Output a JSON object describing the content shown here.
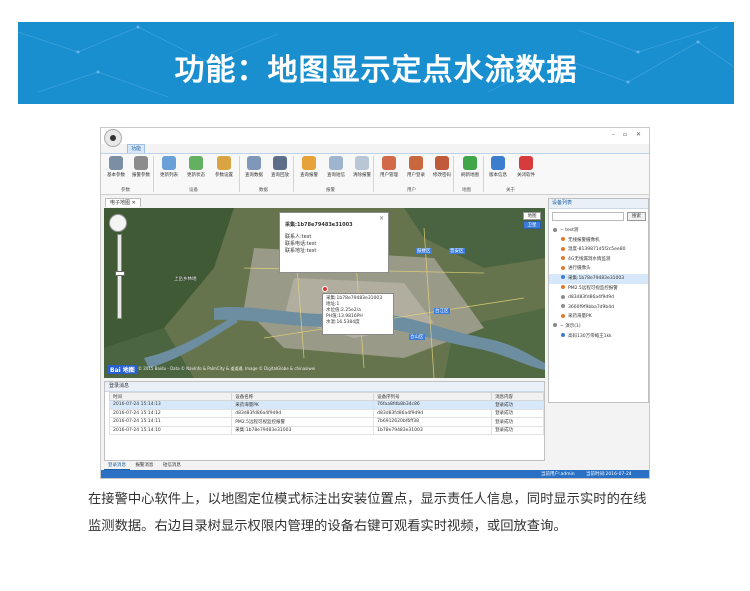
{
  "banner": {
    "title": "功能：地图显示定点水流数据"
  },
  "app": {
    "tab": "功能",
    "window_controls": [
      "–",
      "▫",
      "✕"
    ],
    "ribbon": {
      "buttons": [
        {
          "label": "基本参数",
          "color": "#7a8ea4"
        },
        {
          "label": "报警参数",
          "color": "#8c8c8c"
        },
        {
          "label": "更新列表",
          "color": "#6aa0d8"
        },
        {
          "label": "更新状态",
          "color": "#62b060"
        },
        {
          "label": "参数设置",
          "color": "#d9a441"
        },
        {
          "label": "查询数据",
          "color": "#7f97b8"
        },
        {
          "label": "查询回放",
          "color": "#5e6e88"
        },
        {
          "label": "查询报警",
          "color": "#e8a23a"
        },
        {
          "label": "查询短信",
          "color": "#9fb5cf"
        },
        {
          "label": "清除报警",
          "color": "#b8c6d6"
        },
        {
          "label": "用户管理",
          "color": "#d26a4a"
        },
        {
          "label": "用户登录",
          "color": "#c9683f"
        },
        {
          "label": "修改密码",
          "color": "#c05a3a"
        },
        {
          "label": "刷新地图",
          "color": "#3fa64a"
        },
        {
          "label": "版本信息",
          "color": "#3b7ed0"
        },
        {
          "label": "关闭软件",
          "color": "#d83b3b"
        }
      ],
      "groups": [
        "参数",
        "设备",
        "数据",
        "报警",
        "用户",
        "地图",
        "关于"
      ]
    },
    "doc_tab": "电子地图 ✕",
    "map": {
      "zoom_title": "缩放",
      "map_type_map": "地图",
      "map_type_sat": "卫星",
      "popup": {
        "title": "采集:1b78e79483e31003",
        "contact": "联系人:test",
        "phone": "联系电话:test",
        "address": "联系地址:test"
      },
      "tooltip": {
        "line1": "采集:1b78e79483e31003",
        "line2": "地址:1",
        "line3": "水位值:2.25e2/a",
        "line4": "PH值:13.9816PH",
        "line5": "水温:16.5384度"
      },
      "labels": [
        "上岳乡林地",
        "晋安区",
        "仓山区",
        "鼓楼区",
        "台江区"
      ],
      "logo": "Bai 地图",
      "copyright": "© 2015 Baidu - Data © NavInfo & PalmCity & 道道通, Image © DigitalGlobe & chinasiwei"
    },
    "tree": {
      "title": "设备列表",
      "search_button": "搜索",
      "items": [
        {
          "label": "− test测",
          "color": "#888888"
        },
        {
          "label": "无线报警摄像机",
          "color": "#e27a2a"
        },
        {
          "label": "温度-8139871d5f2c5ee80",
          "color": "#e27a2a"
        },
        {
          "label": "4G无线漏洞水情监测",
          "color": "#e27a2a"
        },
        {
          "label": "进行摄像头",
          "color": "#e27a2a"
        },
        {
          "label": "采集:1b78e79483e31003",
          "color": "#3b7ed0"
        },
        {
          "label": "PM2.5远程可视监控报警",
          "color": "#e27a2a"
        },
        {
          "label": "d83d83fd86a4f9d9d",
          "color": "#8c8c8c"
        },
        {
          "label": "3660f9f9bba7d9b4d",
          "color": "#8c8c8c"
        },
        {
          "label": "采药海量PK",
          "color": "#e27a2a"
        },
        {
          "label": "− 演示(1)",
          "color": "#888888"
        },
        {
          "label": "高码130万带缩王1kk",
          "color": "#3b7ed0"
        }
      ]
    },
    "messages": {
      "title": "登录消息",
      "columns": [
        "时间",
        "设备名称",
        "设备序列号",
        "消息内容"
      ],
      "rows": [
        [
          "2016-07-24 15:14:13",
          "采药海量PK",
          "76faa8fdb8b34c86",
          "登录成功"
        ],
        [
          "2016-07-24 15:14:12",
          "d83d83fd86a4f9d9d",
          "d83d83fd86a4f9d9d",
          "登录成功"
        ],
        [
          "2016-07-24 15:14:11",
          "PM2.5远程可视监控报警",
          "7b6912620bf6ff38",
          "登录成功"
        ],
        [
          "2016-07-24 15:14:10",
          "采集:1b78e79483e31003",
          "1b78e79483e31003",
          "登录成功"
        ]
      ],
      "tabs": [
        "登录消息",
        "报警消息",
        "短信消息"
      ]
    },
    "status": {
      "user": "当前用户:admin",
      "time": "当前时间:2016-07-24 15:14:26"
    }
  },
  "caption": "在接警中心软件上，以地图定位模式标注出安装位置点，显示责任人信息，同时显示实时的在线监测数据。右边目录树显示权限内管理的设备右键可观看实时视频，或回放查询。"
}
